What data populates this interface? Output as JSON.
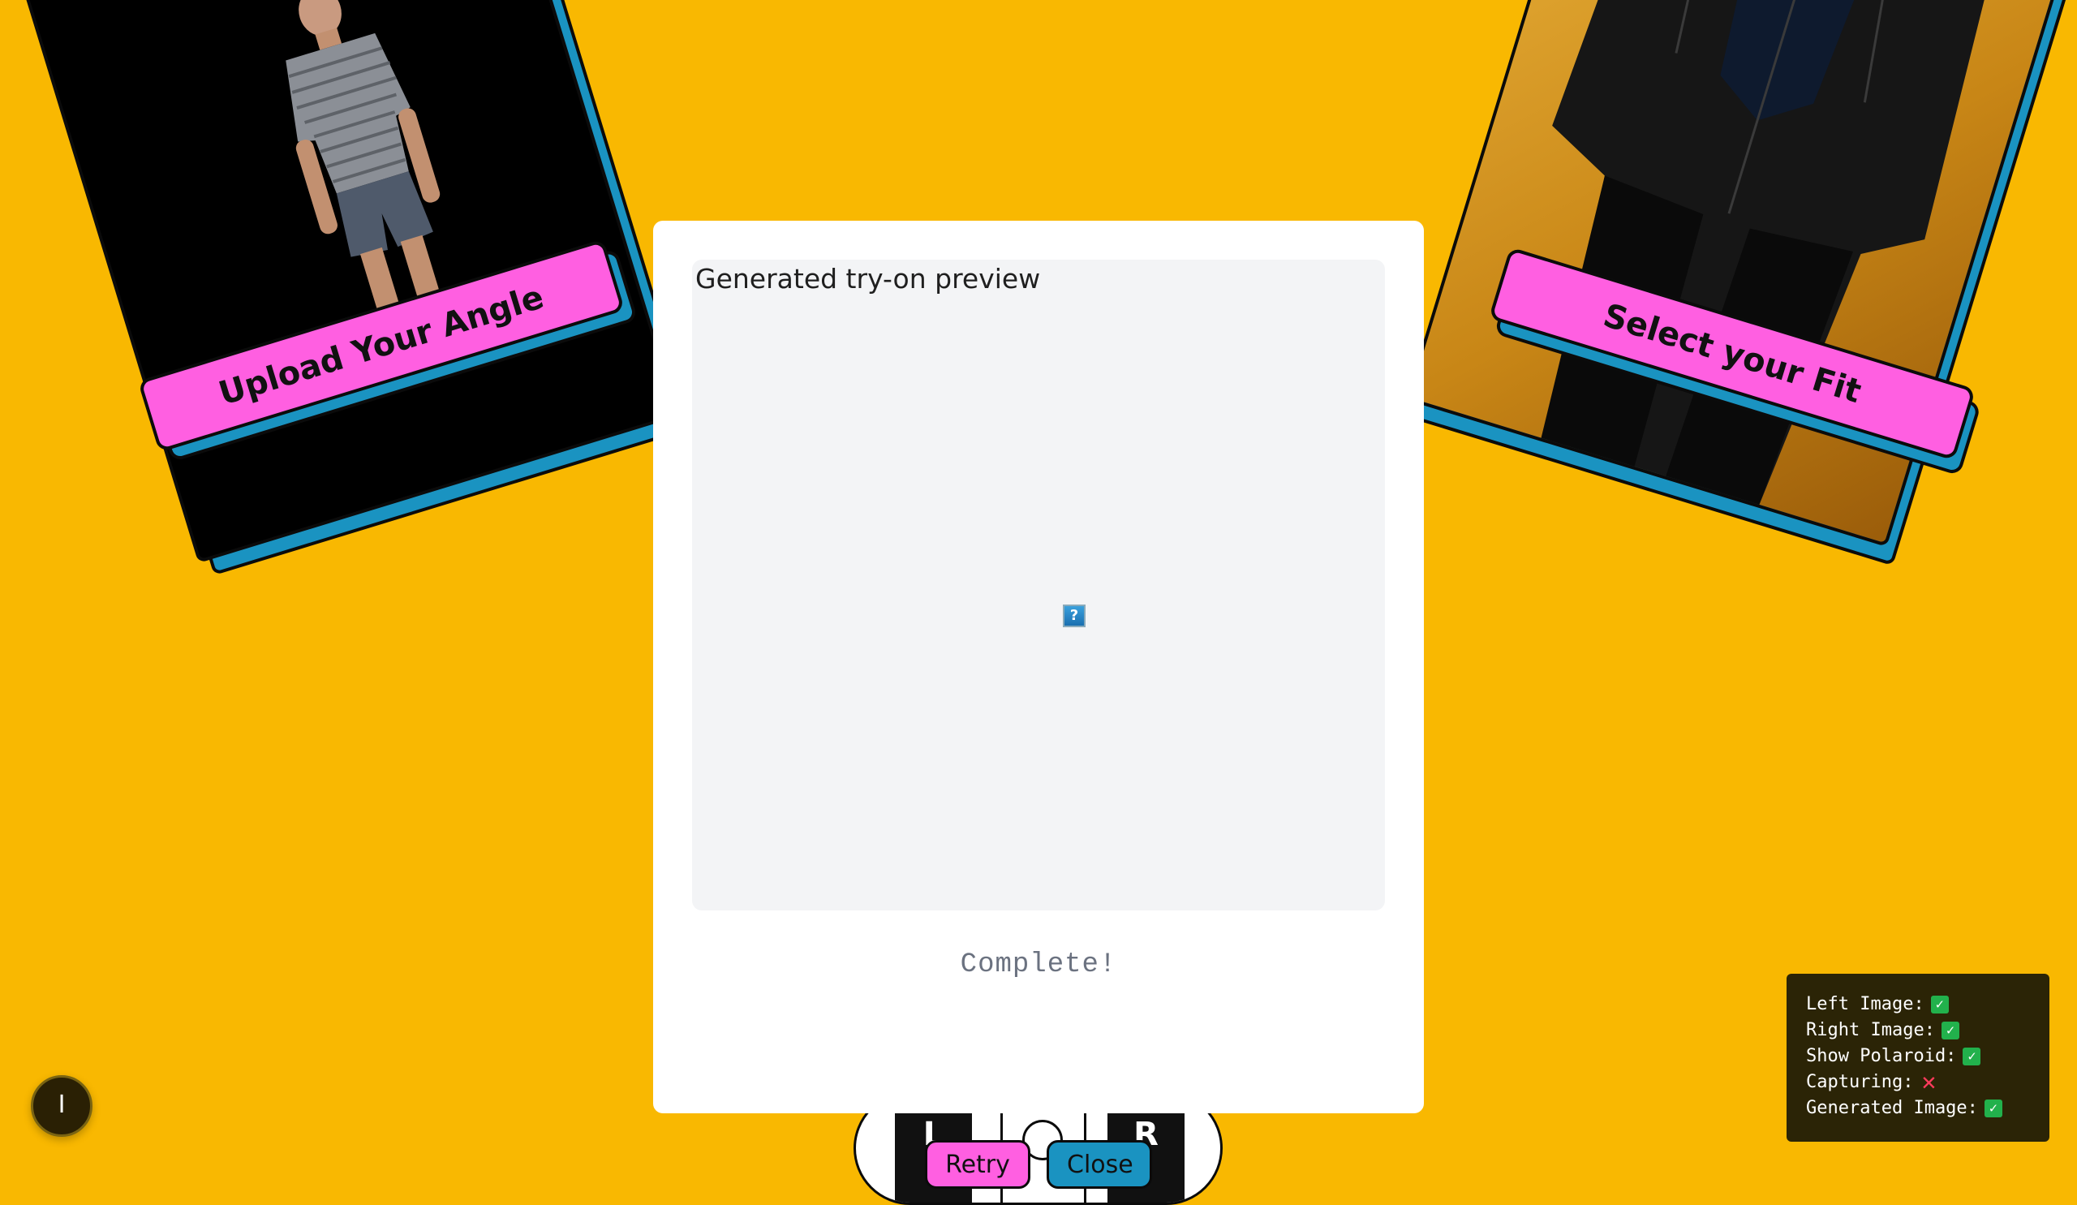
{
  "left_card": {
    "label": "Upload Your Angle"
  },
  "right_card": {
    "label": "Select your Fit"
  },
  "modal": {
    "preview_caption": "Generated try-on preview",
    "broken_image_glyph": "?",
    "status": "Complete!"
  },
  "device": {
    "left_glyph": "L",
    "right_glyph": "R"
  },
  "buttons": {
    "retry": "Retry",
    "close": "Close"
  },
  "debug": {
    "rows": [
      {
        "label": "Left Image:",
        "state": "yes"
      },
      {
        "label": "Right Image:",
        "state": "yes"
      },
      {
        "label": "Show Polaroid:",
        "state": "yes"
      },
      {
        "label": "Capturing:",
        "state": "no"
      },
      {
        "label": "Generated Image:",
        "state": "yes"
      }
    ],
    "yes_glyph": "✓",
    "no_glyph": "✕"
  },
  "fab": {
    "glyph": "I"
  },
  "colors": {
    "background": "#f9b801",
    "pink": "#ff5fe1",
    "blue": "#1a93c1"
  }
}
